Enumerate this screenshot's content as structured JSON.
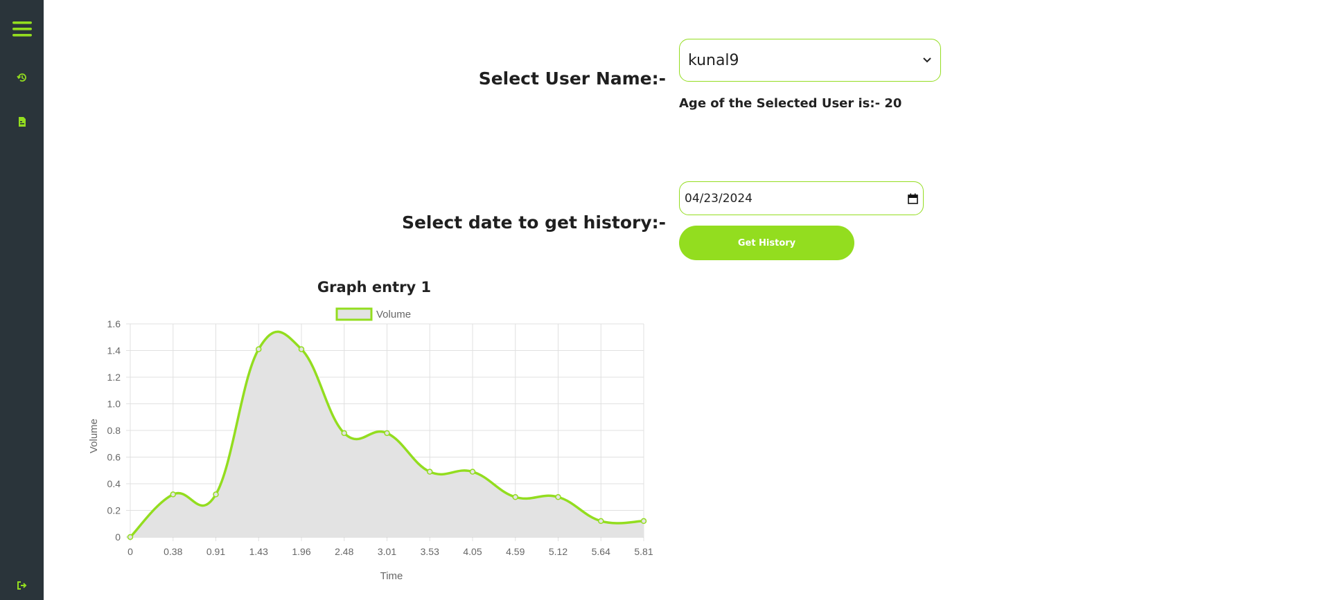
{
  "sidebar": {
    "menu_icon": "hamburger-menu-icon",
    "items": [
      {
        "icon": "history-icon"
      },
      {
        "icon": "document-icon"
      }
    ],
    "logout_icon": "logout-icon"
  },
  "form": {
    "user_label": "Select User Name:-",
    "user_selected": "kunal9",
    "age_text": "Age of the Selected User is:- 20",
    "date_label": "Select date to get history:-",
    "date_value": "04/23/2024",
    "button_label": "Get History"
  },
  "colors": {
    "accent": "#93dd1f",
    "sidebar_bg": "#2a343a",
    "area_fill": "#e3e3e3"
  },
  "chart_data": {
    "type": "line",
    "title": "Graph entry 1",
    "xlabel": "Time",
    "ylabel": "Volume",
    "legend": "top",
    "grid": true,
    "ylim": [
      0,
      1.6
    ],
    "y_ticks": [
      "0",
      "0.2",
      "0.4",
      "0.6",
      "0.8",
      "1.0",
      "1.2",
      "1.4",
      "1.6"
    ],
    "categories": [
      "0",
      "0.38",
      "0.91",
      "1.43",
      "1.96",
      "2.48",
      "3.01",
      "3.53",
      "4.05",
      "4.59",
      "5.12",
      "5.64",
      "5.81"
    ],
    "series": [
      {
        "name": "Volume",
        "values": [
          0,
          0.32,
          0.32,
          1.41,
          1.41,
          0.78,
          0.78,
          0.49,
          0.49,
          0.3,
          0.3,
          0.12,
          0.12
        ],
        "fill": true
      }
    ]
  }
}
